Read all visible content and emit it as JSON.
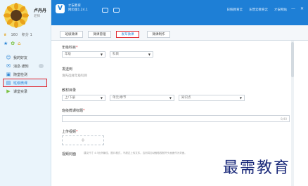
{
  "profile": {
    "name": "卢丹丹",
    "role": "老师",
    "coins": "160",
    "points_label": "积分 1"
  },
  "sidebar": {
    "items": [
      {
        "label": "我的好友",
        "icon": "friends-icon"
      },
      {
        "label": "消息·通知",
        "icon": "mail-icon"
      },
      {
        "label": "随堂检测",
        "icon": "quiz-icon"
      },
      {
        "label": "班级微课",
        "icon": "video-icon"
      },
      {
        "label": "课堂实录",
        "icon": "record-icon"
      }
    ]
  },
  "topbar": {
    "app_name_line1": "才安教育",
    "app_name_line2": "网页版1.24.1",
    "links": [
      "日照教育云",
      "东营云教育云",
      "才安网站"
    ]
  },
  "tabs": [
    {
      "label": "班级微课"
    },
    {
      "label": "微课管理"
    },
    {
      "label": "发布微课"
    },
    {
      "label": "微课制作"
    }
  ],
  "form": {
    "subject_label": "年级科目",
    "grade_select": "年级",
    "subject_select": "科目",
    "send_to_label": "发送到",
    "send_to_hint": "请先选择年级科目",
    "textbook_label": "教材目录",
    "textbook_volume_select": "上/下册",
    "unit_select": "单元/章节",
    "knowledge_select": "知识点",
    "title_label": "班级微课标题",
    "title_counter": "0/40",
    "upload_label": "上传视频",
    "upload_plus": "+",
    "cover_label": "视频封面",
    "cover_hint": "建议尺寸 4:3比例最佳，图片格式，不超过上传文件。否则将自动截取视频开头画面作为封面。"
  },
  "watermark": "最需教育"
}
